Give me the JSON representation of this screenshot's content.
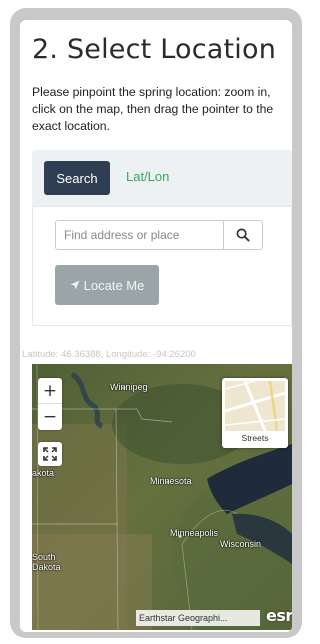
{
  "page": {
    "title": "2. Select Location",
    "instructions": "Please pinpoint the spring location: zoom in, click on the map, then drag the pointer to the exact location."
  },
  "tabs": {
    "search_label": "Search",
    "latlon_label": "Lat/Lon"
  },
  "search": {
    "placeholder": "Find address or place",
    "button_icon": "search-icon",
    "locate_label": "Locate Me",
    "locate_icon": "location-arrow-icon"
  },
  "coords": {
    "text": "Latitude: 46.36388, Longitude: -94.26200"
  },
  "map": {
    "zoom_in": "+",
    "zoom_out": "−",
    "basemap_label": "Streets",
    "labels": {
      "winnipeg": "Winnipeg",
      "minnesota": "Minnesota",
      "minneapolis": "Minneapolis",
      "wisconsin": "Wisconsin",
      "north_dakota_partial": "akota",
      "south_dakota": "South Dakota"
    },
    "attribution": "Earthstar Geographi...",
    "logo": "esri"
  },
  "colors": {
    "primary_tab": "#2f3e53",
    "link_green": "#3aa656",
    "locate_button": "#9ba5a7"
  }
}
